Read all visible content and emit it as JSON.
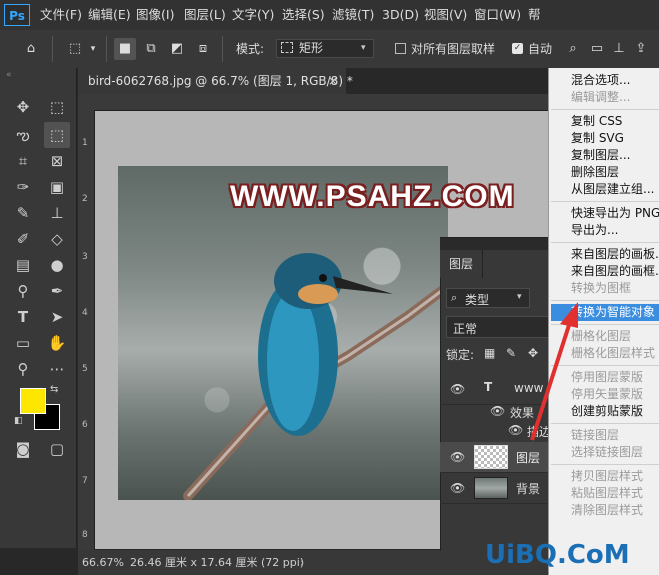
{
  "app": {
    "logo": "Ps"
  },
  "menu": [
    "文件(F)",
    "编辑(E)",
    "图像(I)",
    "图层(L)",
    "文字(Y)",
    "选择(S)",
    "滤镜(T)",
    "3D(D)",
    "视图(V)",
    "窗口(W)",
    "帮"
  ],
  "options_bar": {
    "mode_label": "模式:",
    "mode_value": "矩形",
    "sample_all_label": "对所有图层取样",
    "auto_label": "自动"
  },
  "document": {
    "tab_title": "bird-6062768.jpg @ 66.7% (图层 1, RGB/8) *",
    "watermark": "WWW.PSAHZ.COM"
  },
  "ruler_left": [
    "1",
    "2",
    "3",
    "4",
    "5",
    "6",
    "7",
    "8"
  ],
  "status_bar": {
    "zoom": "66.67%",
    "doc_info": "26.46 厘米 x 17.64 厘米 (72 ppi)"
  },
  "layers_panel": {
    "tab": "图层",
    "filter_kind": "类型",
    "blend_mode": "正常",
    "lock_label": "锁定:",
    "layers": [
      {
        "name": "www",
        "kind": "text"
      },
      {
        "name": "效果",
        "kind": "effects"
      },
      {
        "name": "描边",
        "kind": "effect"
      },
      {
        "name": "图层",
        "kind": "image"
      },
      {
        "name": "背景",
        "kind": "image"
      }
    ]
  },
  "context_menu": [
    {
      "label": "混合选项...",
      "state": "enabled"
    },
    {
      "label": "编辑调整...",
      "state": "disabled"
    },
    {
      "sep": true
    },
    {
      "label": "复制 CSS",
      "state": "enabled"
    },
    {
      "label": "复制 SVG",
      "state": "enabled"
    },
    {
      "label": "复制图层...",
      "state": "enabled"
    },
    {
      "label": "删除图层",
      "state": "enabled"
    },
    {
      "label": "从图层建立组...",
      "state": "enabled"
    },
    {
      "sep": true
    },
    {
      "label": "快速导出为 PNG",
      "state": "enabled"
    },
    {
      "label": "导出为...",
      "state": "enabled"
    },
    {
      "sep": true
    },
    {
      "label": "来自图层的画板...",
      "state": "enabled"
    },
    {
      "label": "来自图层的画框...",
      "state": "enabled"
    },
    {
      "label": "转换为图框",
      "state": "disabled"
    },
    {
      "sep": true
    },
    {
      "label": "转换为智能对象",
      "state": "highlighted"
    },
    {
      "sep": true
    },
    {
      "label": "栅格化图层",
      "state": "disabled"
    },
    {
      "label": "栅格化图层样式",
      "state": "disabled"
    },
    {
      "sep": true
    },
    {
      "label": "停用图层蒙版",
      "state": "disabled"
    },
    {
      "label": "停用矢量蒙版",
      "state": "disabled"
    },
    {
      "label": "创建剪贴蒙版",
      "state": "enabled"
    },
    {
      "sep": true
    },
    {
      "label": "链接图层",
      "state": "disabled"
    },
    {
      "label": "选择链接图层",
      "state": "disabled"
    },
    {
      "sep": true
    },
    {
      "label": "拷贝图层样式",
      "state": "disabled"
    },
    {
      "label": "粘贴图层样式",
      "state": "disabled"
    },
    {
      "label": "清除图层样式",
      "state": "disabled"
    }
  ],
  "site_watermark": "UiBQ.CoM",
  "colors": {
    "foreground": "#ffe600",
    "background": "#000000",
    "highlight": "#3b8de0",
    "arrow": "#e03030"
  }
}
